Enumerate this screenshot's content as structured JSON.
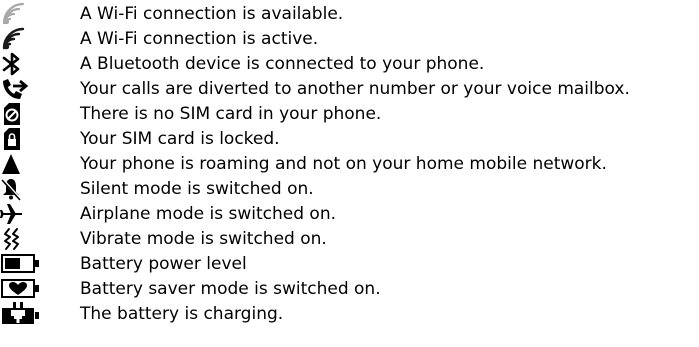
{
  "status_icons": [
    {
      "icon": "wifi-available-icon",
      "description": "A Wi-Fi connection is available."
    },
    {
      "icon": "wifi-active-icon",
      "description": "A Wi-Fi connection is active."
    },
    {
      "icon": "bluetooth-icon",
      "description": "A Bluetooth device is connected to your phone."
    },
    {
      "icon": "call-divert-icon",
      "description": "Your calls are diverted to another number or your voice mailbox."
    },
    {
      "icon": "no-sim-icon",
      "description": "There is no SIM card in your phone."
    },
    {
      "icon": "sim-locked-icon",
      "description": "Your SIM card is locked."
    },
    {
      "icon": "roaming-icon",
      "description": "Your phone is roaming and not on your home mobile network."
    },
    {
      "icon": "silent-mode-icon",
      "description": "Silent mode is switched on."
    },
    {
      "icon": "airplane-mode-icon",
      "description": "Airplane mode is switched on."
    },
    {
      "icon": "vibrate-mode-icon",
      "description": "Vibrate mode is switched on."
    },
    {
      "icon": "battery-level-icon",
      "description": "Battery power level"
    },
    {
      "icon": "battery-saver-icon",
      "description": "Battery saver mode is switched on."
    },
    {
      "icon": "battery-charging-icon",
      "description": "The battery is charging."
    }
  ]
}
